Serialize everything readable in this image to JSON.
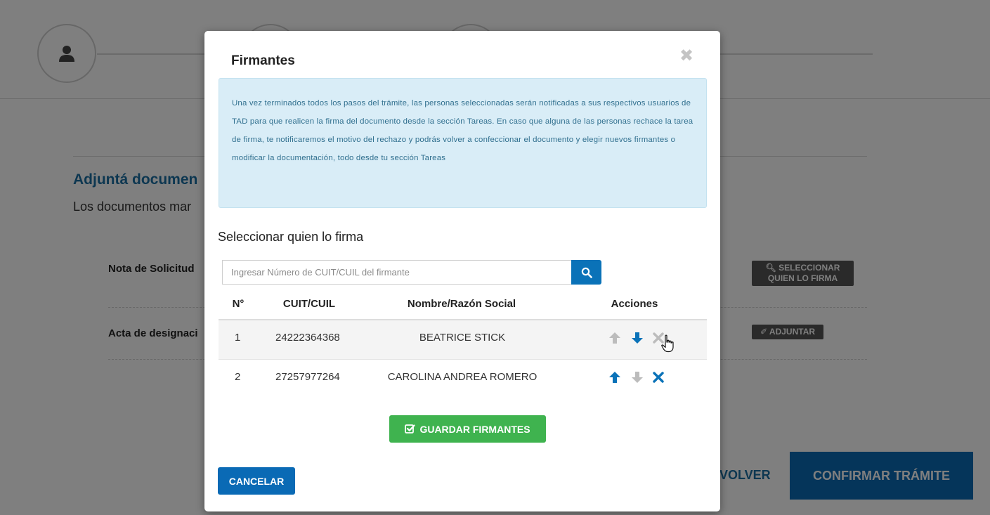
{
  "background": {
    "title": "Adjuntá documen",
    "subtitle": "Los documentos mar",
    "docs": [
      {
        "label": "Nota de Solicitud",
        "button": "SELECCIONAR QUIEN LO FIRMA",
        "button_icon": "search-icon"
      },
      {
        "label": "Acta de designaci",
        "button": "ADJUNTAR",
        "button_icon": "paperclip-icon"
      }
    ],
    "volver_label": "VOLVER",
    "confirm_label": "CONFIRMAR TRÁMITE",
    "accent_color": "#0a6ab5"
  },
  "modal": {
    "title": "Firmantes",
    "info_text": "Una vez terminados todos los pasos del trámite, las personas seleccionadas serán notificadas a sus respectivos usuarios de TAD para que realicen la firma del documento desde la sección Tareas. En caso que alguna de las personas rechace la tarea de firma, te notificaremos el motivo del rechazo y podrás volver a confeccionar el documento y elegir nuevos firmantes o modificar la documentación, todo desde tu sección Tareas",
    "info_color": "#d9edf7",
    "select_title": "Seleccionar quien lo firma",
    "search_placeholder": "Ingresar Número de CUIT/CUIL del firmante",
    "table": {
      "headers": [
        "N°",
        "CUIT/CUIL",
        "Nombre/Razón Social",
        "Acciones"
      ],
      "rows": [
        {
          "no": "1",
          "cuit": "24222364368",
          "name": "BEATRICE STICK",
          "up_enabled": false,
          "down_enabled": true,
          "remove_enabled": false
        },
        {
          "no": "2",
          "cuit": "27257977264",
          "name": "CAROLINA ANDREA ROMERO",
          "up_enabled": true,
          "down_enabled": false,
          "remove_enabled": true
        }
      ]
    },
    "save_label": "GUARDAR FIRMANTES",
    "save_color": "#3fb34f",
    "cancel_label": "CANCELAR"
  }
}
